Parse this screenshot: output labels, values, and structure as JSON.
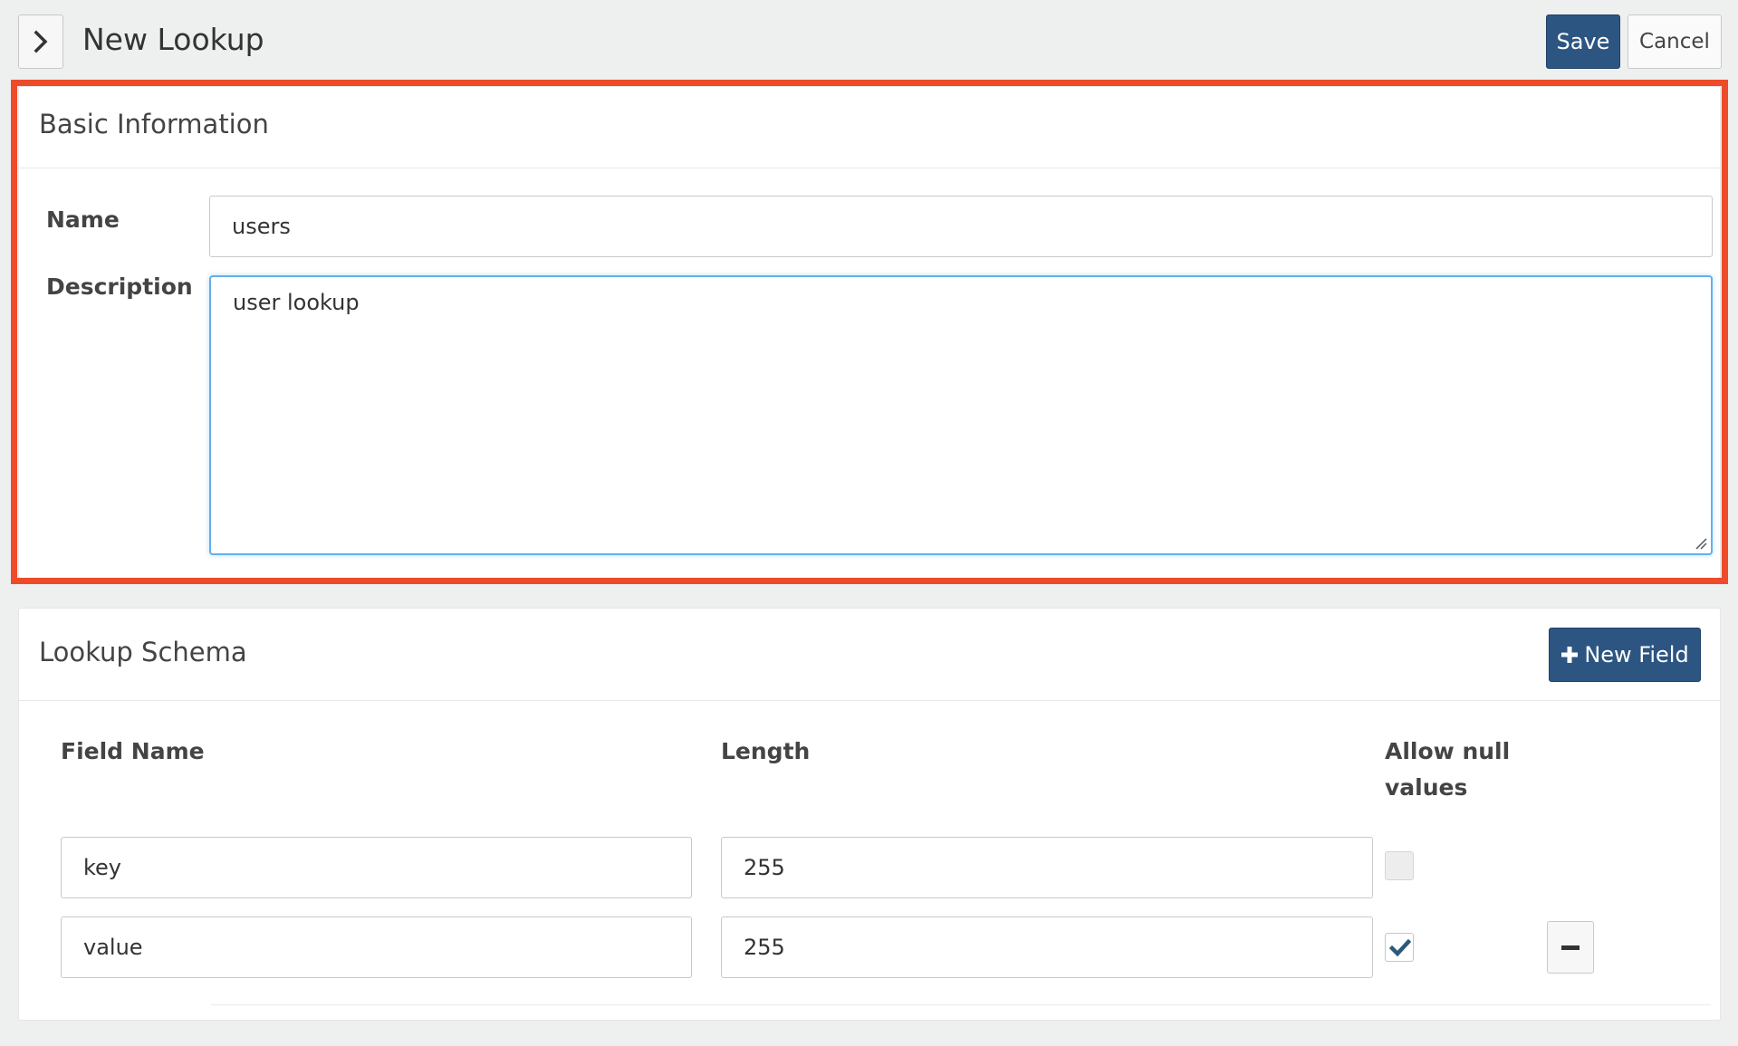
{
  "header": {
    "title": "New Lookup",
    "save_label": "Save",
    "cancel_label": "Cancel"
  },
  "basic_information": {
    "heading": "Basic Information",
    "name_label": "Name",
    "name_value": "users",
    "description_label": "Description",
    "description_value": "user lookup"
  },
  "lookup_schema": {
    "heading": "Lookup Schema",
    "new_field_label": "New Field",
    "columns": {
      "field_name": "Field Name",
      "length": "Length",
      "allow_null": "Allow null values"
    },
    "rows": [
      {
        "field_name": "key",
        "length": "255",
        "allow_null": false
      },
      {
        "field_name": "value",
        "length": "255",
        "allow_null": true
      }
    ]
  },
  "colors": {
    "primary": "#2c5582",
    "highlight": "#ee4b2b",
    "focus": "#66afe9",
    "check": "#2b5a7a"
  }
}
